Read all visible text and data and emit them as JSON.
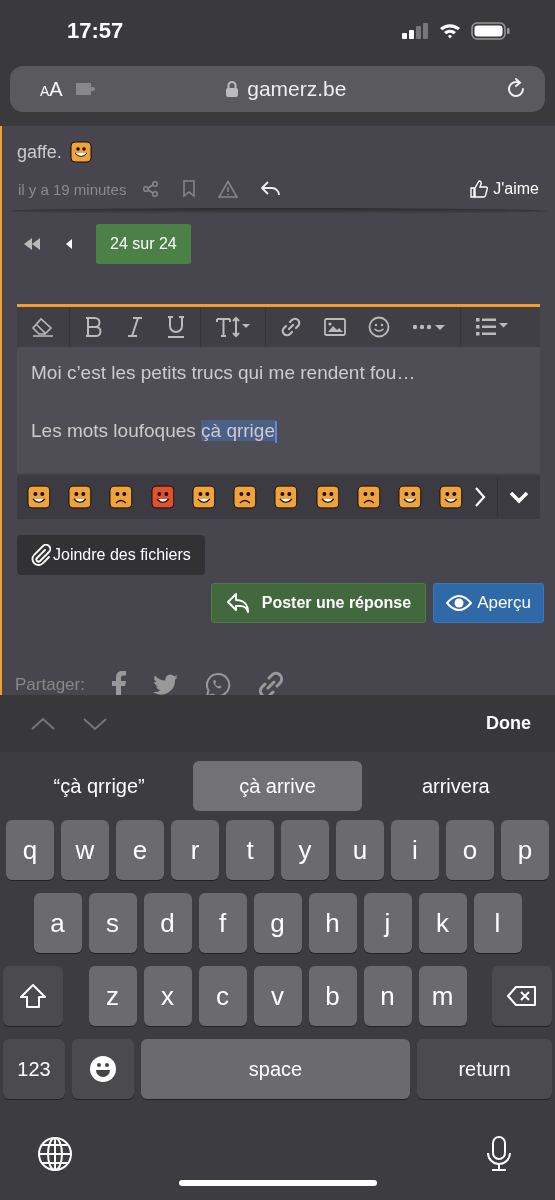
{
  "status_bar": {
    "time": "17:57"
  },
  "browser": {
    "text_size": "AA",
    "url": "gamerz.be"
  },
  "post": {
    "text_end": "gaffe.",
    "time": "il y a 19 minutes",
    "like": "J'aime"
  },
  "pagination": {
    "page": "24 sur 24"
  },
  "editor": {
    "lines": [
      {
        "text": "Moi c’est les petits trucs qui me rendent fou…"
      },
      {
        "text": "Les mots loufoques ",
        "marked": "çà qrrige"
      }
    ]
  },
  "smilies": [
    {
      "color": "#f2a23a"
    },
    {
      "color": "#f2a23a"
    },
    {
      "color": "#f2a23a"
    },
    {
      "color": "#e4502c"
    },
    {
      "color": "#f2a23a"
    },
    {
      "color": "#f2a23a"
    },
    {
      "color": "#f2a23a"
    },
    {
      "color": "#f2a23a"
    },
    {
      "color": "#f2a23a"
    },
    {
      "color": "#f2a23a"
    },
    {
      "color": "#f2a23a"
    }
  ],
  "actions": {
    "attach": "Joindre des fichiers",
    "post": "Poster une réponse",
    "preview": "Aperçu"
  },
  "share": {
    "label": "Partager:"
  },
  "keyboard": {
    "done": "Done",
    "suggestions": [
      {
        "text": "“çà qrrige”",
        "selected": false
      },
      {
        "text": "çà arrive",
        "selected": true
      },
      {
        "text": "arrivera",
        "selected": false
      }
    ],
    "rows": [
      [
        "q",
        "w",
        "e",
        "r",
        "t",
        "y",
        "u",
        "i",
        "o",
        "p"
      ],
      [
        "a",
        "s",
        "d",
        "f",
        "g",
        "h",
        "j",
        "k",
        "l"
      ],
      [
        "z",
        "x",
        "c",
        "v",
        "b",
        "n",
        "m"
      ]
    ],
    "numbers": "123",
    "space": "space",
    "return": "return"
  }
}
